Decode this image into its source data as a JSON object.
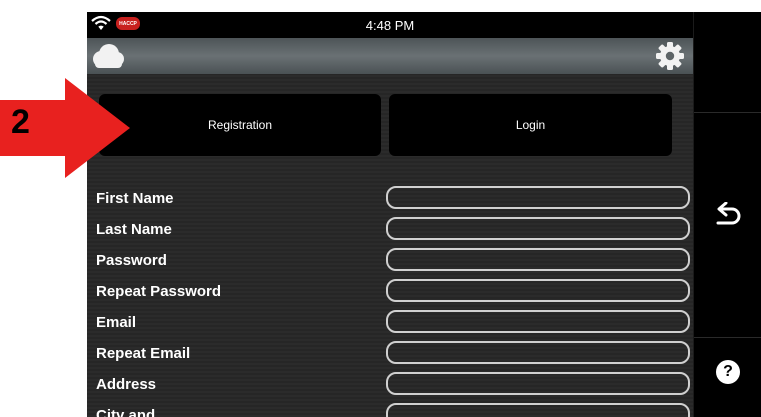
{
  "status_bar": {
    "time": "4:48 PM",
    "badge": "HACCP"
  },
  "toolbar": {
    "cloud_icon": "cloud-icon",
    "settings_icon": "gear-icon"
  },
  "tabs": {
    "registration": "Registration",
    "login": "Login"
  },
  "form": {
    "fields": [
      {
        "label": "First Name",
        "value": ""
      },
      {
        "label": "Last Name",
        "value": ""
      },
      {
        "label": "Password",
        "value": ""
      },
      {
        "label": "Repeat Password",
        "value": ""
      },
      {
        "label": "Email",
        "value": ""
      },
      {
        "label": "Repeat Email",
        "value": ""
      },
      {
        "label": "Address",
        "value": ""
      },
      {
        "label": "City and",
        "value": ""
      }
    ]
  },
  "side_panel": {
    "back_icon": "back-arrow-icon",
    "help_icon": "help-icon",
    "help_label": "?"
  },
  "annotation": {
    "step_number": "2",
    "arrow_color": "#e8211f"
  },
  "colors": {
    "accent_red": "#e8211f",
    "haccp_red": "#c8201e",
    "background": "#2b2b2b",
    "toolbar": "#626a6d"
  }
}
